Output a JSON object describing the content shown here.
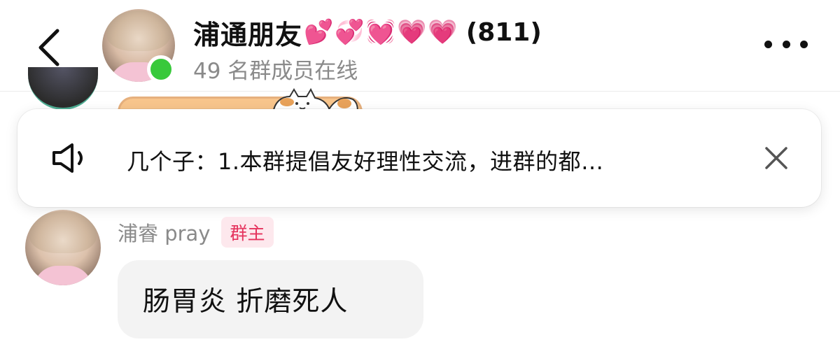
{
  "header": {
    "group_name": "浦通朋友",
    "emojis": [
      "💕",
      "💞",
      "💓",
      "💗",
      "💗"
    ],
    "member_count": "(811)",
    "online_text": "49 名群成员在线",
    "online_color": "#38c93b",
    "back_icon": "chevron-left-icon",
    "more_icon": "more-horizontal-icon"
  },
  "announcement": {
    "icon": "speaker-icon",
    "text": "几个子：1.本群提倡友好理性交流，进群的都…",
    "close_icon": "close-icon"
  },
  "message": {
    "sender_name": "浦睿 pray",
    "role_badge": "群主",
    "role_badge_color": "#e5335d",
    "text": "肠胃炎 折磨死人"
  }
}
